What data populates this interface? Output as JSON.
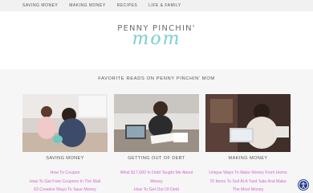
{
  "nav": {
    "items": [
      {
        "label": "SAVING MONEY"
      },
      {
        "label": "MAKING MONEY"
      },
      {
        "label": "RECIPES"
      },
      {
        "label": "LIFE & FAMILY"
      }
    ]
  },
  "logo": {
    "top_text": "PENNY PINCHIN'",
    "script_text": "mom"
  },
  "section": {
    "title": "FAVORITE READS ON PENNY PINCHIN' MOM"
  },
  "columns": [
    {
      "title": "SAVING MONEY",
      "links": [
        "How To Coupon",
        "How To Get Free Coupons In The Mail",
        "63 Creative Ways To Save Money"
      ]
    },
    {
      "title": "GETTING OUT OF DEBT",
      "links": [
        "What $17,000 In Debt Taught Me About",
        "Money",
        "How To Get Out Of Debt"
      ]
    },
    {
      "title": "MAKING MONEY",
      "links": [
        "Unique Ways To Make Money From Home",
        "70 Items To Sell At A Yard Sale And Make",
        "The Most Money"
      ]
    }
  ],
  "colors": {
    "link": "#d26ad1",
    "logo_script": "#7ccdd2",
    "nav_bg": "#f1f1f1",
    "band_bg": "#f6f6f6"
  }
}
